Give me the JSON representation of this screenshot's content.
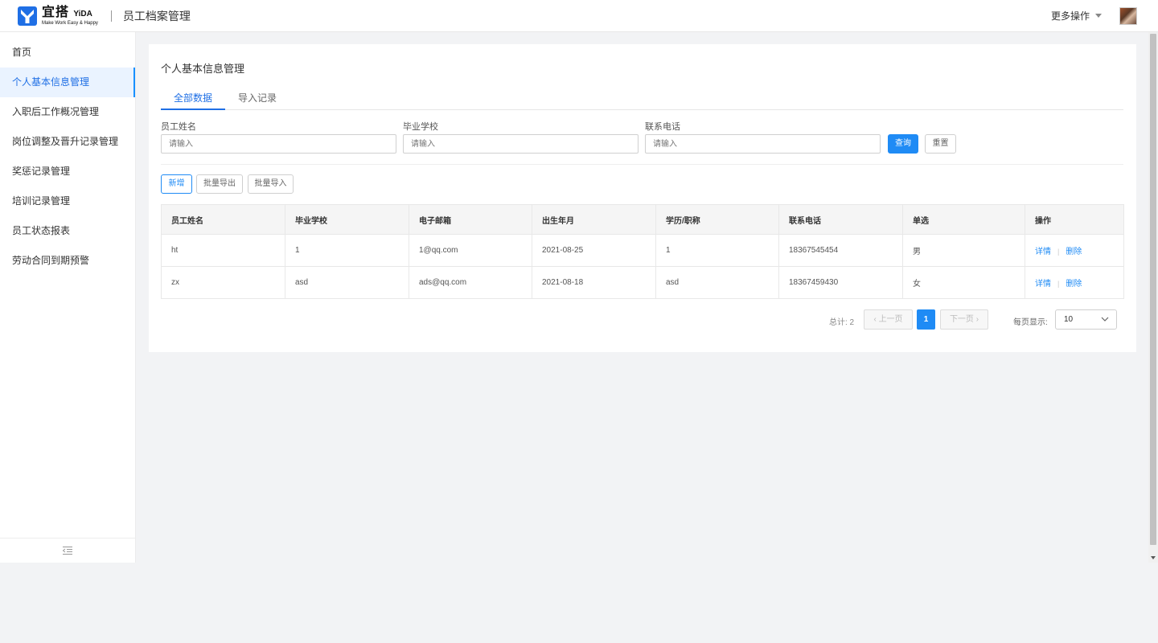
{
  "header": {
    "brand_cn": "宜搭",
    "brand_en": "YiDA",
    "brand_slogan": "Make Work Easy & Happy",
    "app_title": "员工档案管理",
    "more_ops": "更多操作"
  },
  "sidebar": {
    "items": [
      {
        "label": "首页"
      },
      {
        "label": "个人基本信息管理"
      },
      {
        "label": "入职后工作概况管理"
      },
      {
        "label": "岗位调整及晋升记录管理"
      },
      {
        "label": "奖惩记录管理"
      },
      {
        "label": "培训记录管理"
      },
      {
        "label": "员工状态报表"
      },
      {
        "label": "劳动合同到期预警"
      }
    ],
    "active_index": 1
  },
  "page": {
    "title": "个人基本信息管理",
    "tabs": [
      {
        "label": "全部数据"
      },
      {
        "label": "导入记录"
      }
    ]
  },
  "search": {
    "fields": [
      {
        "label": "员工姓名",
        "placeholder": "请输入"
      },
      {
        "label": "毕业学校",
        "placeholder": "请输入"
      },
      {
        "label": "联系电话",
        "placeholder": "请输入"
      }
    ],
    "query_label": "查询",
    "reset_label": "重置"
  },
  "actions": {
    "add_label": "新增",
    "export_label": "批量导出",
    "import_label": "批量导入"
  },
  "table": {
    "columns": [
      "员工姓名",
      "毕业学校",
      "电子邮箱",
      "出生年月",
      "学历/职称",
      "联系电话",
      "单选",
      "操作"
    ],
    "rows": [
      {
        "name": "ht",
        "school": "1",
        "email": "1@qq.com",
        "birth": "2021-08-25",
        "degree": "1",
        "phone": "18367545454",
        "gender": "男"
      },
      {
        "name": "zx",
        "school": "asd",
        "email": "ads@qq.com",
        "birth": "2021-08-18",
        "degree": "asd",
        "phone": "18367459430",
        "gender": "女"
      }
    ],
    "detail_label": "详情",
    "delete_label": "删除",
    "op_separator": "|"
  },
  "pagination": {
    "total_text": "总计: 2",
    "prev_label": "上一页",
    "next_label": "下一页",
    "current_page": "1",
    "page_size_label": "每页显示:",
    "page_size": "10"
  },
  "colors": {
    "accent": "#1f8bf5",
    "brand": "#1f6fe5"
  }
}
